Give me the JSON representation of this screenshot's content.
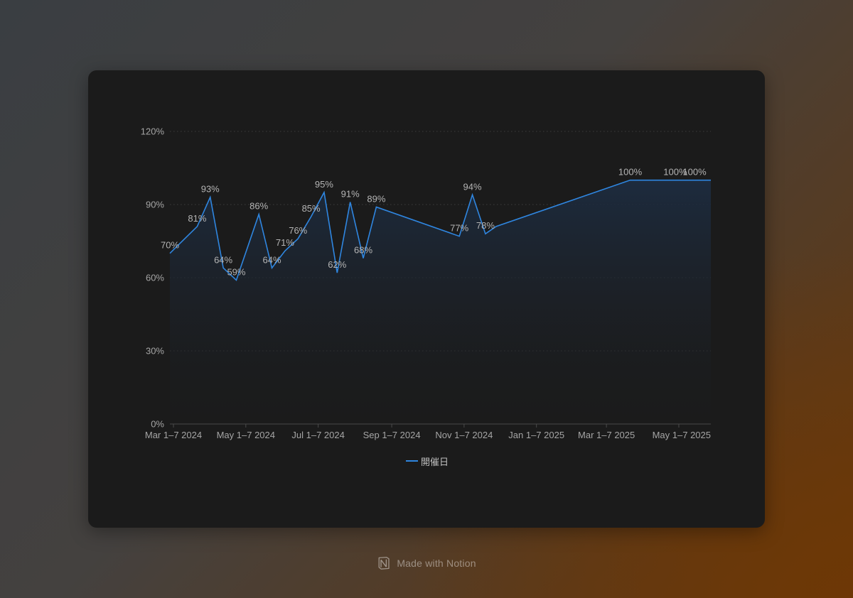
{
  "colors": {
    "line": "#2f86e0",
    "fill_top": "#1b2a3c",
    "grid": "#3d3d3d",
    "axis": "#4a4a4a",
    "tick_text": "#a5a5a5",
    "label_text": "#b4b4b4",
    "legend_text": "#bfbfbf"
  },
  "footer": {
    "text": "Made with Notion",
    "icon": "notion-icon"
  },
  "chart_data": {
    "type": "area",
    "title": "",
    "xlabel": "",
    "ylabel": "",
    "ylim": [
      0,
      120
    ],
    "yticks": [
      "0%",
      "30%",
      "60%",
      "90%",
      "120%"
    ],
    "xlim": [
      "2024-03-01",
      "2025-05-31"
    ],
    "grid": true,
    "legend_position": "bottom",
    "xticks": [
      {
        "date": "2024-03-04",
        "label": "Mar 1–7 2024"
      },
      {
        "date": "2024-05-04",
        "label": "May 1–7 2024"
      },
      {
        "date": "2024-07-04",
        "label": "Jul 1–7 2024"
      },
      {
        "date": "2024-09-04",
        "label": "Sep 1–7 2024"
      },
      {
        "date": "2024-11-04",
        "label": "Nov 1–7 2024"
      },
      {
        "date": "2025-01-04",
        "label": "Jan 1–7 2025"
      },
      {
        "date": "2025-03-04",
        "label": "Mar 1–7 2025"
      },
      {
        "date": "2025-05-04",
        "label": "May 1–7 2025"
      }
    ],
    "series": [
      {
        "name": "開催日",
        "points": [
          {
            "x": "2024-03-01",
            "y": 70,
            "label": "70%"
          },
          {
            "x": "2024-03-24",
            "y": 81,
            "label": "81%"
          },
          {
            "x": "2024-04-04",
            "y": 93,
            "label": "93%"
          },
          {
            "x": "2024-04-15",
            "y": 64,
            "label": "64%"
          },
          {
            "x": "2024-04-26",
            "y": 59,
            "label": "59%"
          },
          {
            "x": "2024-05-15",
            "y": 86,
            "label": "86%"
          },
          {
            "x": "2024-05-26",
            "y": 64,
            "label": "64%"
          },
          {
            "x": "2024-06-06",
            "y": 71,
            "label": "71%"
          },
          {
            "x": "2024-06-17",
            "y": 76,
            "label": "76%"
          },
          {
            "x": "2024-06-28",
            "y": 85,
            "label": "85%"
          },
          {
            "x": "2024-07-09",
            "y": 95,
            "label": "95%"
          },
          {
            "x": "2024-07-20",
            "y": 62,
            "label": "62%"
          },
          {
            "x": "2024-07-31",
            "y": 91,
            "label": "91%"
          },
          {
            "x": "2024-08-11",
            "y": 68,
            "label": "68%"
          },
          {
            "x": "2024-08-22",
            "y": 89,
            "label": "89%"
          },
          {
            "x": "2024-10-31",
            "y": 77,
            "label": "77%"
          },
          {
            "x": "2024-11-11",
            "y": 94,
            "label": "94%"
          },
          {
            "x": "2024-11-22",
            "y": 78,
            "label": "78%"
          },
          {
            "x": "2024-12-01",
            "y": 81,
            "label": ""
          },
          {
            "x": "2025-03-24",
            "y": 100,
            "label": "100%"
          },
          {
            "x": "2025-05-01",
            "y": 100,
            "label": "100%"
          },
          {
            "x": "2025-05-31",
            "y": 100,
            "label": "100%"
          }
        ]
      }
    ]
  }
}
